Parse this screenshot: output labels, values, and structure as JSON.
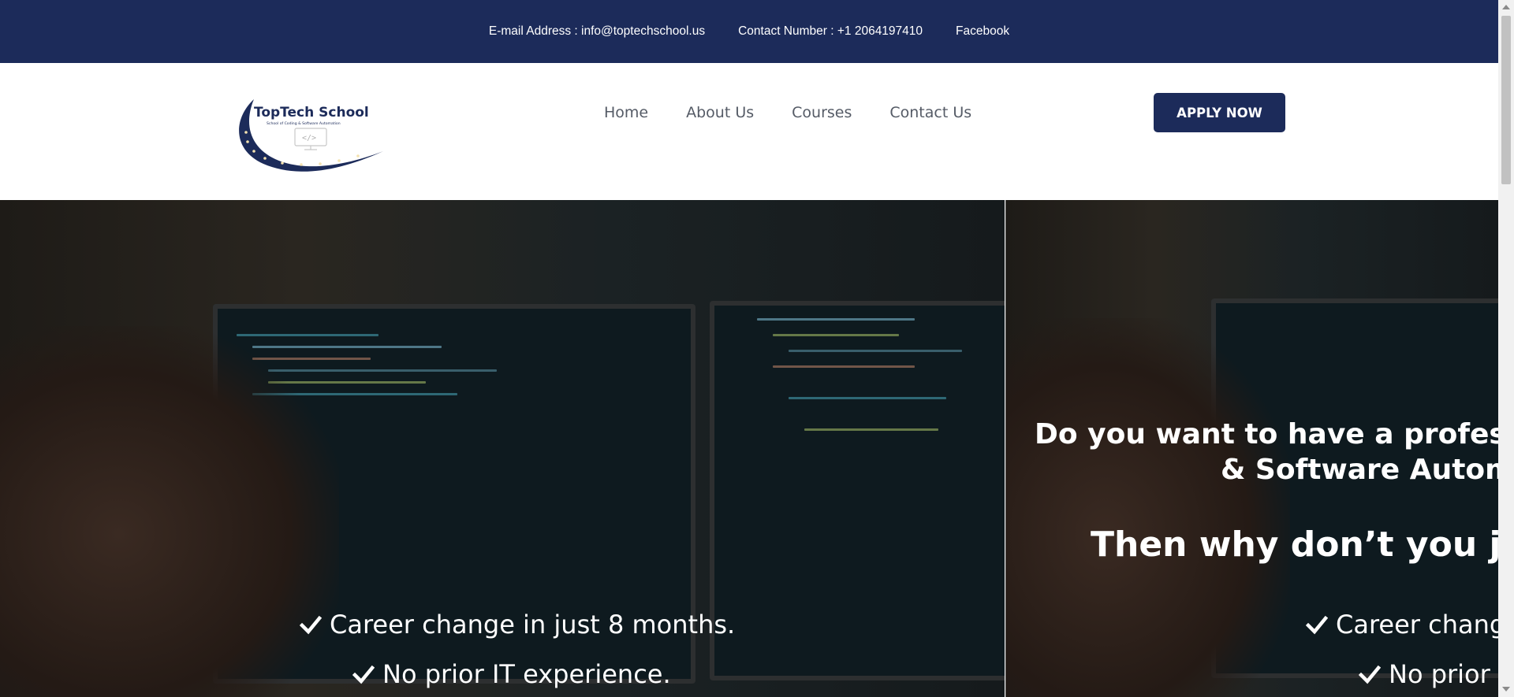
{
  "topbar": {
    "email": "E-mail Address : info@toptechschool.us",
    "phone": "Contact Number : +1 2064197410",
    "facebook": "Facebook"
  },
  "logo": {
    "name": "TopTech School",
    "tagline": "School of Coding & Software Automation",
    "icon_text": "</>"
  },
  "nav": {
    "items": [
      "Home",
      "About Us",
      "Courses",
      "Contact Us"
    ]
  },
  "apply_button": "APPLY NOW",
  "hero": {
    "question_line1": "Do you want to have a professi",
    "question_line2": "& Software Automat",
    "headline": "Then why don’t you joi",
    "bullets_a": [
      "Career change in just 8 months.",
      "No prior IT experience."
    ],
    "bullets_b": [
      "Career change",
      "No prior I"
    ]
  },
  "colors": {
    "brand_navy": "#1c2b5a",
    "nav_text": "#555b66",
    "white": "#ffffff"
  }
}
